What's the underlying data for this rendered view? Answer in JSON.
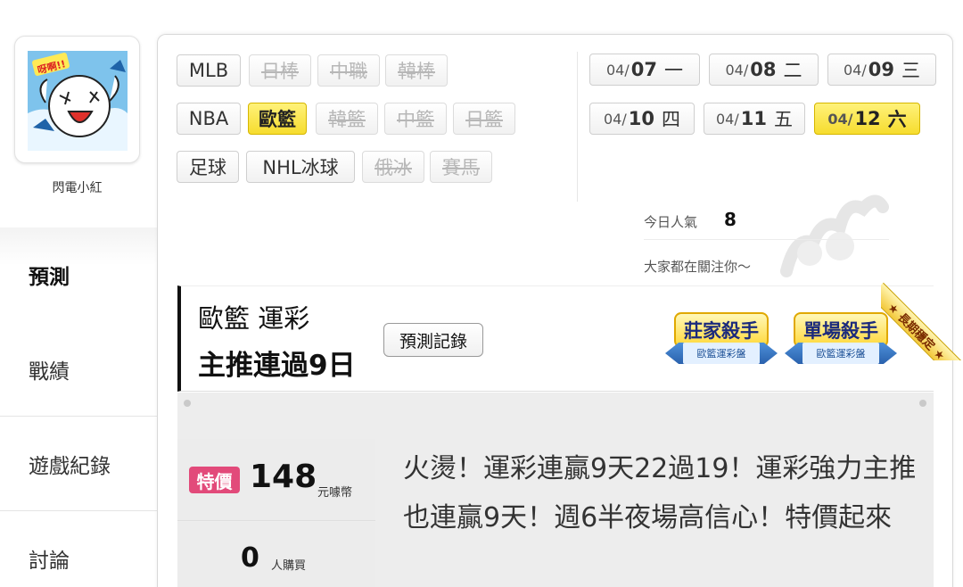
{
  "user": {
    "name": "閃電小紅",
    "avatar": "crying-cartoon-avatar"
  },
  "nav": {
    "items": [
      {
        "label": "預測",
        "active": true
      },
      {
        "label": "戰績",
        "active": false
      },
      {
        "label": "遊戲紀錄",
        "active": false
      },
      {
        "label": "討論",
        "active": false
      }
    ]
  },
  "sports": {
    "rows": [
      [
        {
          "label": "MLB",
          "state": "normal"
        },
        {
          "label": "日棒",
          "state": "disabled"
        },
        {
          "label": "中職",
          "state": "disabled"
        },
        {
          "label": "韓棒",
          "state": "disabled"
        }
      ],
      [
        {
          "label": "NBA",
          "state": "normal"
        },
        {
          "label": "歐籃",
          "state": "active"
        },
        {
          "label": "韓籃",
          "state": "disabled"
        },
        {
          "label": "中籃",
          "state": "disabled"
        },
        {
          "label": "日籃",
          "state": "disabled"
        }
      ],
      [
        {
          "label": "足球",
          "state": "normal"
        },
        {
          "label": "NHL冰球",
          "state": "normal"
        },
        {
          "label": "俄冰",
          "state": "disabled"
        },
        {
          "label": "賽馬",
          "state": "disabled"
        }
      ]
    ]
  },
  "dates": [
    {
      "prefix": "04/",
      "day": "07",
      "weekday": "一",
      "active": false
    },
    {
      "prefix": "04/",
      "day": "08",
      "weekday": "二",
      "active": false
    },
    {
      "prefix": "04/",
      "day": "09",
      "weekday": "三",
      "active": false
    },
    {
      "prefix": "04/",
      "day": "10",
      "weekday": "四",
      "active": false
    },
    {
      "prefix": "04/",
      "day": "11",
      "weekday": "五",
      "active": false
    },
    {
      "prefix": "04/",
      "day": "12",
      "weekday": "六",
      "active": true
    }
  ],
  "popularity": {
    "label": "今日人氣",
    "value": "8",
    "note": "大家都在關注你～"
  },
  "banner": {
    "line1": "歐籃 運彩",
    "line2": "主推連過9日",
    "history_button": "預測記錄",
    "badges": [
      {
        "title": "莊家殺手",
        "subtitle": "歐籃運彩盤"
      },
      {
        "title": "單場殺手",
        "subtitle": "歐籃運彩盤"
      }
    ],
    "corner_label": "★ 長期穩定 ★"
  },
  "offer": {
    "sale_label": "特價",
    "price": "148",
    "price_unit": "元噱幣",
    "buyers": "0",
    "buyers_unit": "人購買",
    "headline": "火燙！運彩連贏9天22過19！運彩強力主推也連贏9天！週6半夜場高信心！特價起來"
  },
  "colors": {
    "accent_yellow": "#f6dc2e",
    "sale_pink": "#e24a7a",
    "badge_blue": "#2a61ad"
  }
}
